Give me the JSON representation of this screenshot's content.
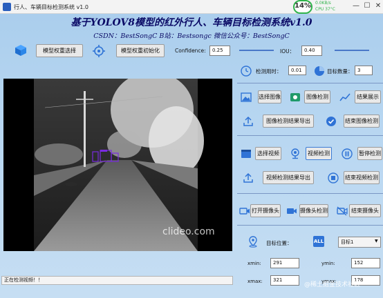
{
  "window": {
    "title": "行人、车辆目标检测系统 v1.0",
    "perf_percent": "14%",
    "net_up": "0.0KB/s",
    "net_down": "CPU 37°C"
  },
  "header": {
    "title": "基于YOLOV8模型的红外行人、车辆目标检测系统v1.0",
    "subtitle": "CSDN：BestSongC   B站：Bestsongc   微信公众号：BestSongC"
  },
  "toolbar": {
    "select_weight_label": "模型权重选择",
    "init_weight_label": "模型权重初始化",
    "confidence_label": "Confidence:",
    "confidence_value": "0.25",
    "iou_label": "IOU：",
    "iou_value": "0.40"
  },
  "stats": {
    "time_label": "检测用时：",
    "time_value": "0.01",
    "count_label": "目标数量：",
    "count_value": "3"
  },
  "image_section": {
    "select_label": "选择图像",
    "detect_label": "图像检测",
    "show_label": "结果展示",
    "export_label": "图像检测结果导出",
    "end_label": "结束图像检测"
  },
  "video_section": {
    "select_label": "选择视频",
    "detect_label": "视频检测",
    "pause_label": "暂停检测",
    "export_label": "视频检测结果导出",
    "end_label": "结束视频检测"
  },
  "camera_section": {
    "open_label": "打开摄像头",
    "detect_label": "摄像头检测",
    "end_label": "结束摄像头"
  },
  "target": {
    "pos_label": "目标位置：",
    "all_badge": "ALL",
    "select_value": "目标1",
    "xmin_label": "xmin:",
    "xmin_value": "291",
    "ymin_label": "ymin:",
    "ymin_value": "152",
    "xmax_label": "xmax:",
    "xmax_value": "321",
    "ymax_label": "ymax:",
    "ymax_value": "178"
  },
  "status": {
    "text": "正在检测视频！！"
  },
  "video": {
    "watermark": "clideo.com"
  },
  "page_watermark": "@稀土掘金技术社区",
  "colors": {
    "title_color": "#0a0a66",
    "accent": "#2f73d6",
    "detection_box": "#7a2be0"
  }
}
